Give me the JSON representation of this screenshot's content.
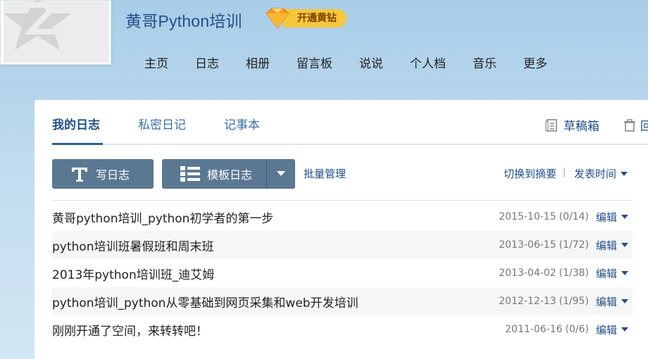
{
  "header": {
    "site_title": "黄哥Python培训",
    "vip_label": "开通黄钻",
    "nav": [
      "主页",
      "日志",
      "相册",
      "留言板",
      "说说",
      "个人档",
      "音乐",
      "更多"
    ]
  },
  "tabs": {
    "mine": "我的日志",
    "private": "私密日记",
    "notes": "记事本",
    "drafts": "草稿箱",
    "recycle": "回"
  },
  "toolbar": {
    "write": "写日志",
    "template": "模板日志",
    "batch": "批量管理",
    "switch_view": "切换到摘要",
    "separator": "|",
    "sort": "发表时间"
  },
  "posts": [
    {
      "title": "黄哥python培训_python初学者的第一步",
      "date": "2015-10-15",
      "counts": "(0/14)",
      "edit": "编辑"
    },
    {
      "title": "python培训班暑假班和周末班",
      "date": "2013-06-15",
      "counts": "(1/72)",
      "edit": "编辑"
    },
    {
      "title": "2013年python培训班_迪艾姆",
      "date": "2013-04-02",
      "counts": "(1/38)",
      "edit": "编辑"
    },
    {
      "title": "python培训_python从零基础到网页采集和web开发培训",
      "date": "2012-12-13",
      "counts": "(1/95)",
      "edit": "编辑"
    },
    {
      "title": "刚刚开通了空间，来转转吧！",
      "date": "2011-06-16",
      "counts": "(0/6)",
      "edit": "编辑"
    }
  ],
  "icons": {
    "avatar": "star-logo-icon",
    "vip": "diamond-icon",
    "write": "text-t-icon",
    "template": "list-icon",
    "dropdown": "chevron-down-icon",
    "drafts": "draft-icon",
    "recycle": "trash-icon"
  },
  "colors": {
    "accent": "#1f4f8b",
    "button": "#5b7892",
    "vip": "#f6c73a"
  }
}
